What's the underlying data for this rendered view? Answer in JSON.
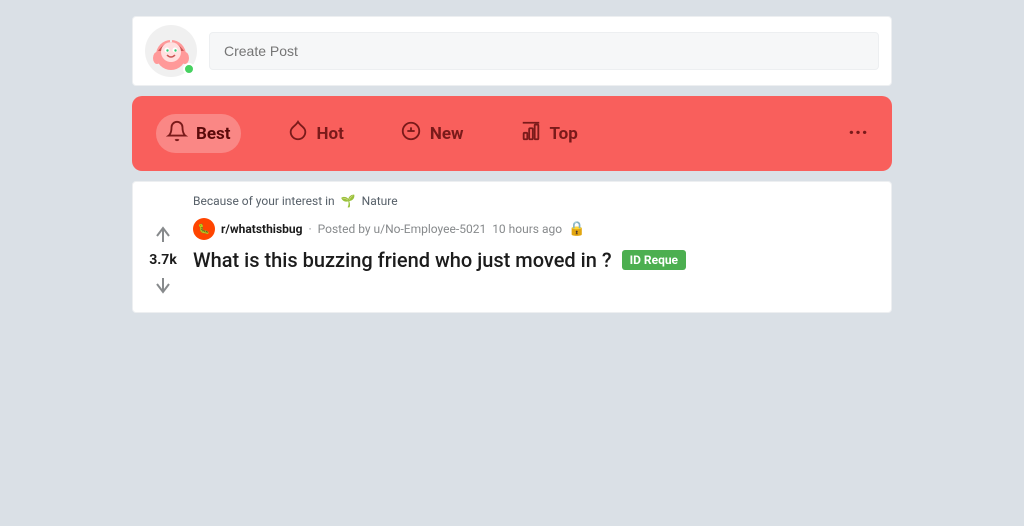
{
  "createPost": {
    "placeholder": "Create Post"
  },
  "sortBar": {
    "items": [
      {
        "id": "best",
        "label": "Best",
        "icon": "bell",
        "active": true
      },
      {
        "id": "hot",
        "label": "Hot",
        "icon": "drop",
        "active": false
      },
      {
        "id": "new",
        "label": "New",
        "icon": "gear",
        "active": false
      },
      {
        "id": "top",
        "label": "Top",
        "icon": "chart",
        "active": false
      }
    ],
    "moreLabel": "···"
  },
  "post": {
    "interestPrefix": "Because of your interest in",
    "interestEmoji": "🌱",
    "interestLabel": "Nature",
    "subredditIcon": "🐛",
    "subredditName": "r/whatsthisbug",
    "postedBy": "Posted by u/No-Employee-5021",
    "timeAgo": "10 hours ago",
    "lockIcon": "🔒",
    "voteCount": "3.7k",
    "title": "What is this buzzing friend who just moved in ?",
    "flairText": "ID Reque"
  },
  "colors": {
    "sortBarBg": "#f95f5c",
    "flairGreen": "#4caf50"
  }
}
